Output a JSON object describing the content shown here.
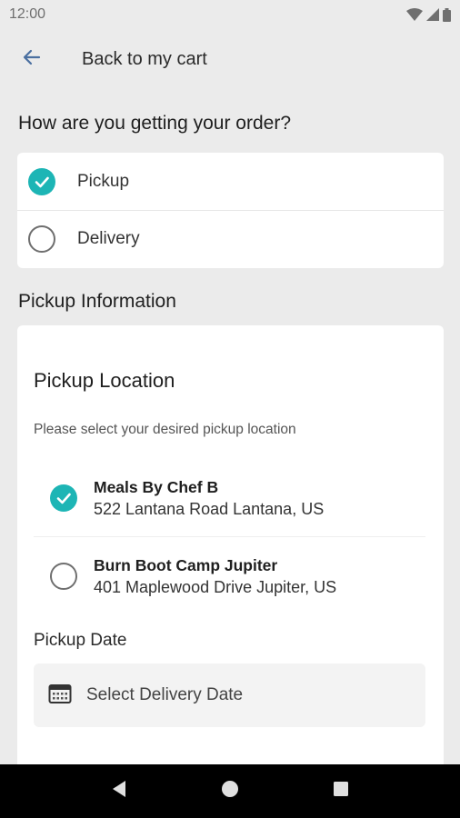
{
  "status_bar": {
    "time": "12:00",
    "icons": [
      "wifi-icon",
      "cell-signal-icon",
      "battery-icon"
    ]
  },
  "app_bar": {
    "back_icon": "arrow-left-icon",
    "title": "Back to my cart"
  },
  "fulfillment": {
    "heading": "How are you getting your order?",
    "options": [
      {
        "label": "Pickup",
        "selected": true
      },
      {
        "label": "Delivery",
        "selected": false
      }
    ]
  },
  "pickup_info": {
    "heading": "Pickup Information",
    "card_title": "Pickup Location",
    "card_subtitle": "Please select your desired pickup location",
    "locations": [
      {
        "name": "Meals By Chef B",
        "address": " 522 Lantana Road Lantana, US",
        "selected": true
      },
      {
        "name": "Burn Boot Camp Jupiter",
        "address": "401 Maplewood Drive Jupiter, US",
        "selected": false
      }
    ],
    "date_label": "Pickup Date",
    "date_placeholder": "Select Delivery Date",
    "date_icon": "calendar-icon"
  },
  "nav_bar": {
    "icons": [
      "back-triangle-icon",
      "home-circle-icon",
      "recents-square-icon"
    ]
  },
  "colors": {
    "accent": "#1db5b5",
    "background": "#ebebeb",
    "card": "#ffffff"
  }
}
